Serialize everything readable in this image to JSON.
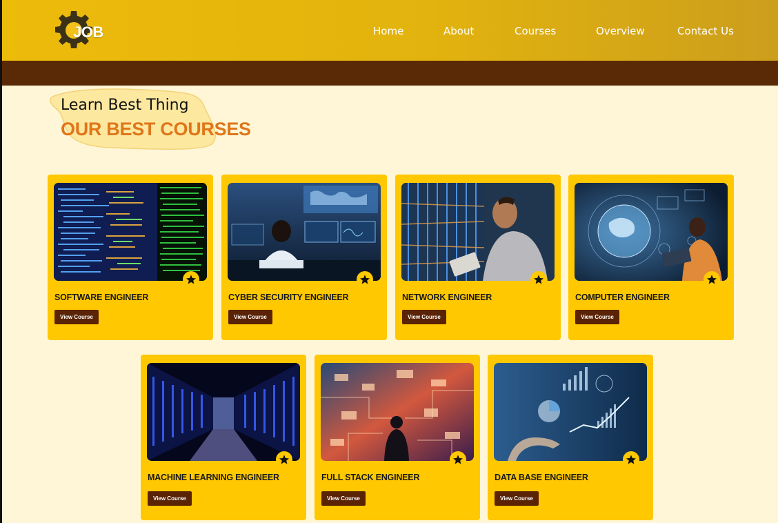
{
  "brand": {
    "logo_text": "JOB"
  },
  "nav": {
    "items": [
      "Home",
      "About",
      "Courses",
      "Overview",
      "Contact Us"
    ]
  },
  "hero": {
    "subtitle": "Learn Best Thing",
    "title": "OUR BEST COURSES"
  },
  "courses": [
    {
      "title": "SOFTWARE ENGINEER",
      "button": "View Course",
      "image": "code-screens"
    },
    {
      "title": "CYBER SECURITY ENGINEER",
      "button": "View Course",
      "image": "security-monitors"
    },
    {
      "title": "NETWORK ENGINEER",
      "button": "View Course",
      "image": "server-rack-tablet"
    },
    {
      "title": "COMPUTER ENGINEER",
      "button": "View Course",
      "image": "holographic-globe"
    },
    {
      "title": "MACHINE LEARNING ENGINEER",
      "button": "View Course",
      "image": "data-center-aisle"
    },
    {
      "title": "FULL STACK ENGINEER",
      "button": "View Course",
      "image": "neon-circuit-person"
    },
    {
      "title": "DATA BASE ENGINEER",
      "button": "View Course",
      "image": "hand-charts"
    }
  ],
  "colors": {
    "header": "#e8b80c",
    "band": "#5a2a06",
    "page": "#fef6d6",
    "card": "#ffc800",
    "accent_title": "#e0761a",
    "button": "#5a2306"
  }
}
